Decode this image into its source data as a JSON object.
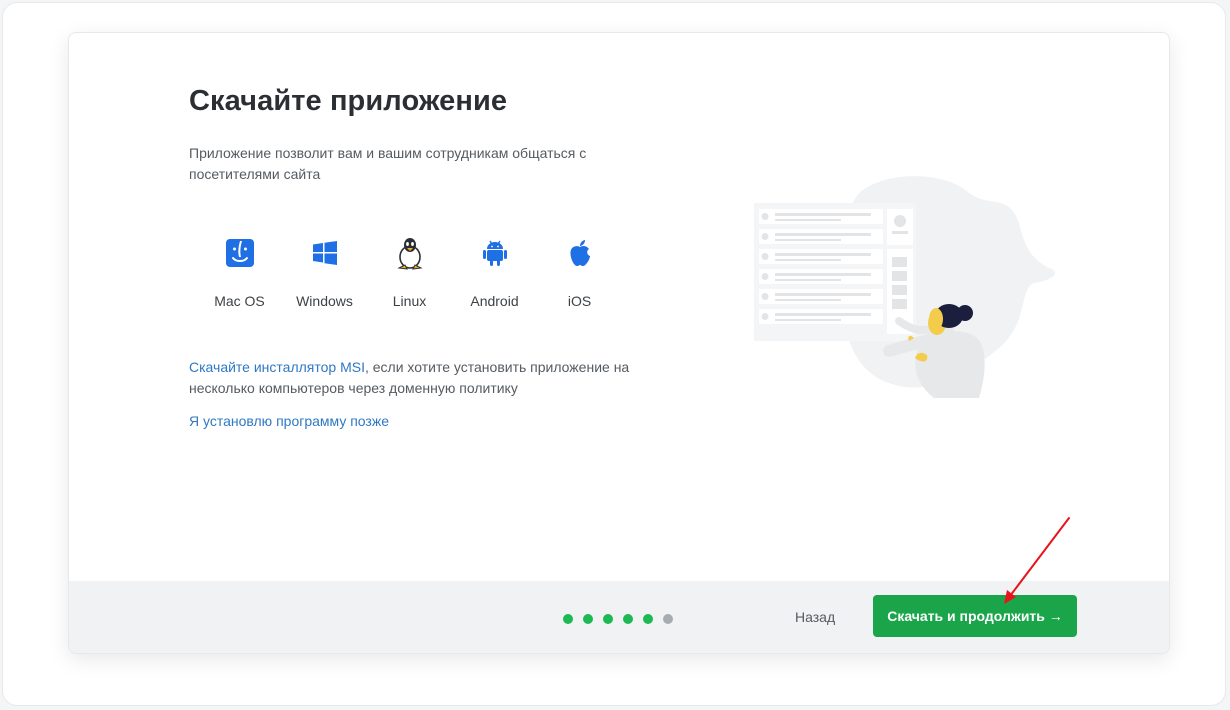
{
  "page": {
    "title": "Скачайте приложение",
    "subtitle": "Приложение позволит вам и вашим сотрудникам общаться с посетителями сайта",
    "platforms": [
      {
        "label": "Mac OS",
        "icon": "finder-icon"
      },
      {
        "label": "Windows",
        "icon": "windows-icon"
      },
      {
        "label": "Linux",
        "icon": "linux-penguin-icon"
      },
      {
        "label": "Android",
        "icon": "android-icon"
      },
      {
        "label": "iOS",
        "icon": "apple-icon"
      }
    ],
    "msi_link": "Скачайте инсталлятор MSI",
    "msi_text": ", если хотите установить приложение на несколько компьютеров через доменную политику",
    "later_link": "Я установлю программу позже"
  },
  "footer": {
    "steps_total": 6,
    "steps_done": 5,
    "back_label": "Назад",
    "next_label": "Скачать и продолжить →"
  },
  "colors": {
    "accent_green": "#1aa54b",
    "link_blue": "#2f78c4",
    "icon_blue": "#1f6fe5",
    "annotation_red": "#e8141c"
  }
}
